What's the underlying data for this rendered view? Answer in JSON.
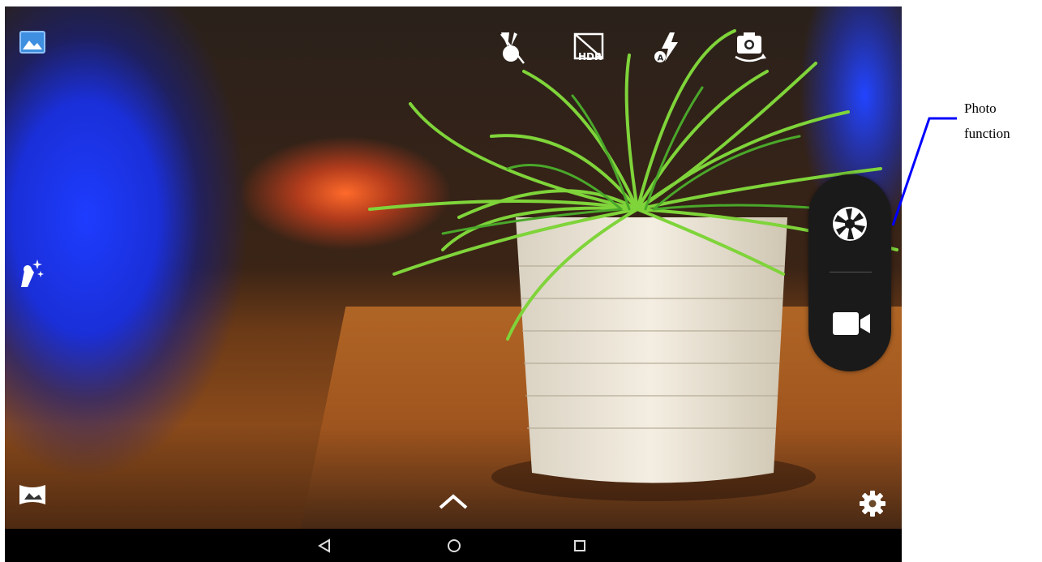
{
  "top_bar": {
    "icons": [
      {
        "name": "gesture-peace-icon"
      },
      {
        "name": "hdr-off-icon",
        "label": "HDR"
      },
      {
        "name": "flash-auto-icon",
        "label": "A"
      },
      {
        "name": "switch-camera-icon"
      }
    ]
  },
  "side_controls": {
    "gallery": {
      "name": "gallery-thumbnail-icon"
    },
    "beauty": {
      "name": "beauty-mode-icon"
    },
    "panorama": {
      "name": "panorama-icon"
    }
  },
  "mode_switch": {
    "photo": {
      "name": "shutter-aperture-icon"
    },
    "video": {
      "name": "video-camera-icon"
    }
  },
  "bottom_controls": {
    "expand": {
      "name": "chevron-up-icon"
    },
    "settings": {
      "name": "gear-icon"
    }
  },
  "nav_bar": {
    "buttons": [
      {
        "name": "back-icon"
      },
      {
        "name": "home-icon"
      },
      {
        "name": "recents-icon"
      }
    ]
  },
  "annotation": {
    "label": "Photo\nfunction",
    "line_color": "#0000ff"
  },
  "colors": {
    "ui_icon": "#ffffff",
    "gallery_icon": "#3f8fe0",
    "mode_switch_bg": "#1a1a1a",
    "nav_bar_bg": "#000000"
  }
}
